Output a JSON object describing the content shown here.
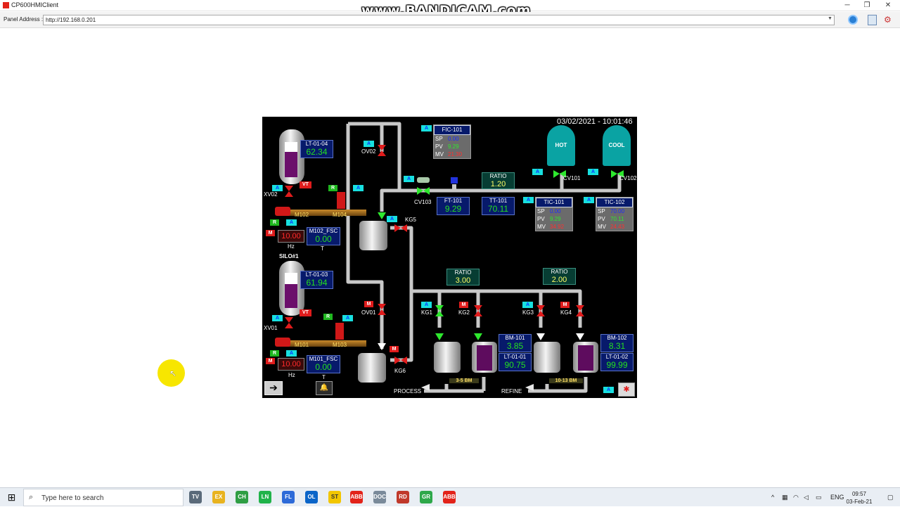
{
  "window": {
    "title": "CP600HMIClient",
    "watermark": "www.BANDICAM.com",
    "controls": {
      "minimize": "─",
      "restore": "❐",
      "close": "✕"
    }
  },
  "address_bar": {
    "label": "Panel Address :",
    "value": "http://192.168.0.201"
  },
  "hmi": {
    "datetime": "03/02/2021 - 10:01:46",
    "tanks": {
      "hot": "HOT",
      "cool": "COOL",
      "silo": "SILO#1"
    },
    "level_transmitters": [
      {
        "name": "LT-01-04",
        "value": "62.34"
      },
      {
        "name": "LT-01-03",
        "value": "61.94"
      },
      {
        "name": "LT-01-01",
        "value": "90.75"
      },
      {
        "name": "LT-01-02",
        "value": "99.99"
      }
    ],
    "fic": {
      "name": "FIC-101",
      "sp_label": "SP",
      "sp": "0.00",
      "pv_label": "PV",
      "pv": "9.29",
      "mv_label": "MV",
      "mv": "21.30"
    },
    "tic101": {
      "name": "TIC-101",
      "sp_label": "SP",
      "sp": "0.00",
      "pv_label": "PV",
      "pv": "9.29",
      "mv_label": "MV",
      "mv": "34.92"
    },
    "tic102": {
      "name": "TIC-102",
      "sp_label": "SP",
      "sp": "70.00",
      "pv_label": "PV",
      "pv": "70.11",
      "mv_label": "MV",
      "mv": "24.43"
    },
    "ft101": {
      "name": "FT-101",
      "value": "9.29"
    },
    "tt101": {
      "name": "TT-101",
      "value": "70.11"
    },
    "ratios": [
      {
        "name": "RATIO",
        "value": "1.20"
      },
      {
        "name": "RATIO",
        "value": "3.00"
      },
      {
        "name": "RATIO",
        "value": "2.00"
      }
    ],
    "fsc": [
      {
        "name": "M102_FSC",
        "value": "0.00",
        "unit": "T"
      },
      {
        "name": "M101_FSC",
        "value": "0.00",
        "unit": "T"
      }
    ],
    "bm": [
      {
        "name": "BM-101",
        "value": "3.85"
      },
      {
        "name": "BM-102",
        "value": "8.31"
      }
    ],
    "hz": [
      {
        "value": "10.00",
        "unit": "Hz"
      },
      {
        "value": "10.00",
        "unit": "Hz"
      }
    ],
    "labels": {
      "xv02": "XV02",
      "xv01": "XV01",
      "ov02": "OV02",
      "ov01": "OV01",
      "kg5": "KG5",
      "kg6": "KG6",
      "kg1": "KG1",
      "kg2": "KG2",
      "kg3": "KG3",
      "kg4": "KG4",
      "cv103": "CV103",
      "cv101": "CV101",
      "cv102": "CV102",
      "m102": "M102",
      "m104": "M104",
      "m101": "M101",
      "m103": "M103",
      "process": "PROCESS",
      "refine": "REFINE",
      "grade1": "3-5 BM",
      "grade2": "10-13 BM"
    },
    "badges": {
      "a": "A",
      "r": "R",
      "m": "M",
      "vt": "VT"
    },
    "buttons": {
      "nav": "➔",
      "alarm": "🔔",
      "settings": "✱"
    }
  },
  "taskbar": {
    "start_icon": "⊞",
    "search_placeholder": "Type here to search",
    "apps": [
      "TV",
      "EX",
      "CH",
      "LN",
      "FL",
      "OL",
      "ST",
      "ABB",
      "DOC",
      "RD",
      "GR",
      "ABB"
    ],
    "tray": {
      "chevron": "^",
      "lang": "ENG"
    },
    "time": "09:57",
    "date": "03-Feb-21"
  },
  "colors": {
    "hmi_bg": "#000000",
    "value_green": "#25e01f",
    "alarm_red": "#e01c1c",
    "badge_cyan": "#18e0e0",
    "tank_teal": "#0aa3a3",
    "box_blue": "#071a6b"
  }
}
